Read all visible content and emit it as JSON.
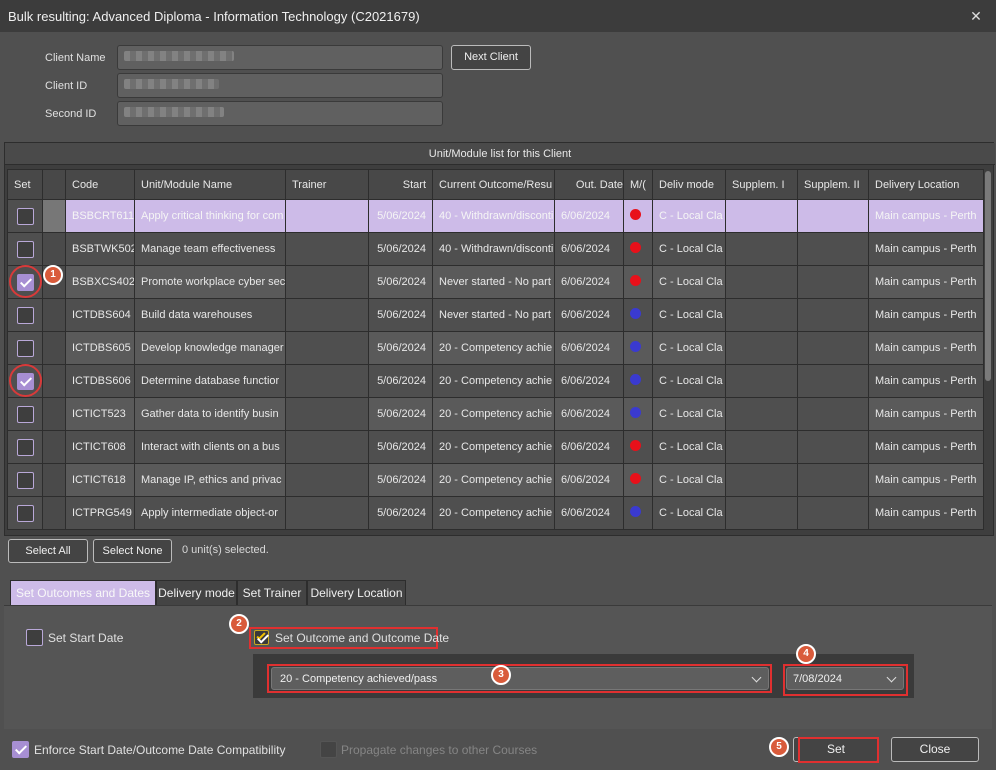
{
  "window": {
    "title": "Bulk resulting: Advanced Diploma - Information Technology (C2021679)",
    "close": "✕"
  },
  "client": {
    "name_label": "Client Name",
    "id_label": "Client ID",
    "second_id_label": "Second ID",
    "next_client": "Next Client"
  },
  "grid": {
    "title": "Unit/Module list for this Client",
    "headers": [
      "Set",
      "",
      "Code",
      "Unit/Module Name",
      "Trainer",
      "Start",
      "Current Outcome/Resu",
      "Out. Date",
      "M/(",
      "Deliv mode",
      "Supplem. I",
      "Supplem. II",
      "Delivery Location"
    ],
    "rows": [
      {
        "checked": false,
        "code": "BSBCRT611",
        "name": "Apply critical thinking for com",
        "start": "5/06/2024",
        "outcome": "40 - Withdrawn/disconti",
        "out_date": "6/06/2024",
        "dot": "#e8101a",
        "deliv": "C - Local Cla",
        "location": "Main campus - Perth"
      },
      {
        "checked": false,
        "code": "BSBTWK502",
        "name": "Manage team effectiveness",
        "start": "5/06/2024",
        "outcome": "40 - Withdrawn/disconti",
        "out_date": "6/06/2024",
        "dot": "#e8101a",
        "deliv": "C - Local Cla",
        "location": "Main campus - Perth"
      },
      {
        "checked": true,
        "code": "BSBXCS402",
        "name": "Promote workplace cyber sec",
        "start": "5/06/2024",
        "outcome": "Never started - No part",
        "out_date": "6/06/2024",
        "dot": "#e8101a",
        "deliv": "C - Local Cla",
        "location": "Main campus - Perth"
      },
      {
        "checked": false,
        "code": "ICTDBS604",
        "name": "Build data warehouses",
        "start": "5/06/2024",
        "outcome": "Never started - No part",
        "out_date": "6/06/2024",
        "dot": "#3a3ad0",
        "deliv": "C - Local Cla",
        "location": "Main campus - Perth"
      },
      {
        "checked": false,
        "code": "ICTDBS605",
        "name": "Develop knowledge manager",
        "start": "5/06/2024",
        "outcome": "20 - Competency achie",
        "out_date": "6/06/2024",
        "dot": "#3a3ad0",
        "deliv": "C - Local Cla",
        "location": "Main campus - Perth"
      },
      {
        "checked": true,
        "code": "ICTDBS606",
        "name": "Determine database functior",
        "start": "5/06/2024",
        "outcome": "20 - Competency achie",
        "out_date": "6/06/2024",
        "dot": "#3a3ad0",
        "deliv": "C - Local Cla",
        "location": "Main campus - Perth"
      },
      {
        "checked": false,
        "code": "ICTICT523",
        "name": "Gather data to identify busin",
        "start": "5/06/2024",
        "outcome": "20 - Competency achie",
        "out_date": "6/06/2024",
        "dot": "#3a3ad0",
        "deliv": "C - Local Cla",
        "location": "Main campus - Perth"
      },
      {
        "checked": false,
        "code": "ICTICT608",
        "name": "Interact with clients on a bus",
        "start": "5/06/2024",
        "outcome": "20 - Competency achie",
        "out_date": "6/06/2024",
        "dot": "#e8101a",
        "deliv": "C - Local Cla",
        "location": "Main campus - Perth"
      },
      {
        "checked": false,
        "code": "ICTICT618",
        "name": "Manage IP, ethics and privac",
        "start": "5/06/2024",
        "outcome": "20 - Competency achie",
        "out_date": "6/06/2024",
        "dot": "#e8101a",
        "deliv": "C - Local Cla",
        "location": "Main campus - Perth"
      },
      {
        "checked": false,
        "code": "ICTPRG549",
        "name": "Apply intermediate object-or",
        "start": "5/06/2024",
        "outcome": "20 - Competency achie",
        "out_date": "6/06/2024",
        "dot": "#3a3ad0",
        "deliv": "C - Local Cla",
        "location": "Main campus - Perth"
      }
    ]
  },
  "selection": {
    "select_all": "Select All",
    "select_none": "Select None",
    "status": "0 unit(s) selected."
  },
  "tabs": [
    "Set Outcomes and Dates",
    "Delivery mode",
    "Set Trainer",
    "Delivery Location"
  ],
  "panel": {
    "set_start_date": "Set Start Date",
    "set_outcome_date": "Set Outcome and Outcome Date",
    "outcome_value": "20 - Competency achieved/pass",
    "date_value": "7/08/2024"
  },
  "footer": {
    "enforce": "Enforce Start Date/Outcome Date Compatibility",
    "propagate": "Propagate changes to other Courses",
    "set": "Set",
    "close": "Close"
  },
  "annotations": [
    "1",
    "2",
    "3",
    "4",
    "5"
  ],
  "colors": {
    "accent": "#a78fd3",
    "highlight": "#e03030",
    "badge": "#d95b3b"
  }
}
